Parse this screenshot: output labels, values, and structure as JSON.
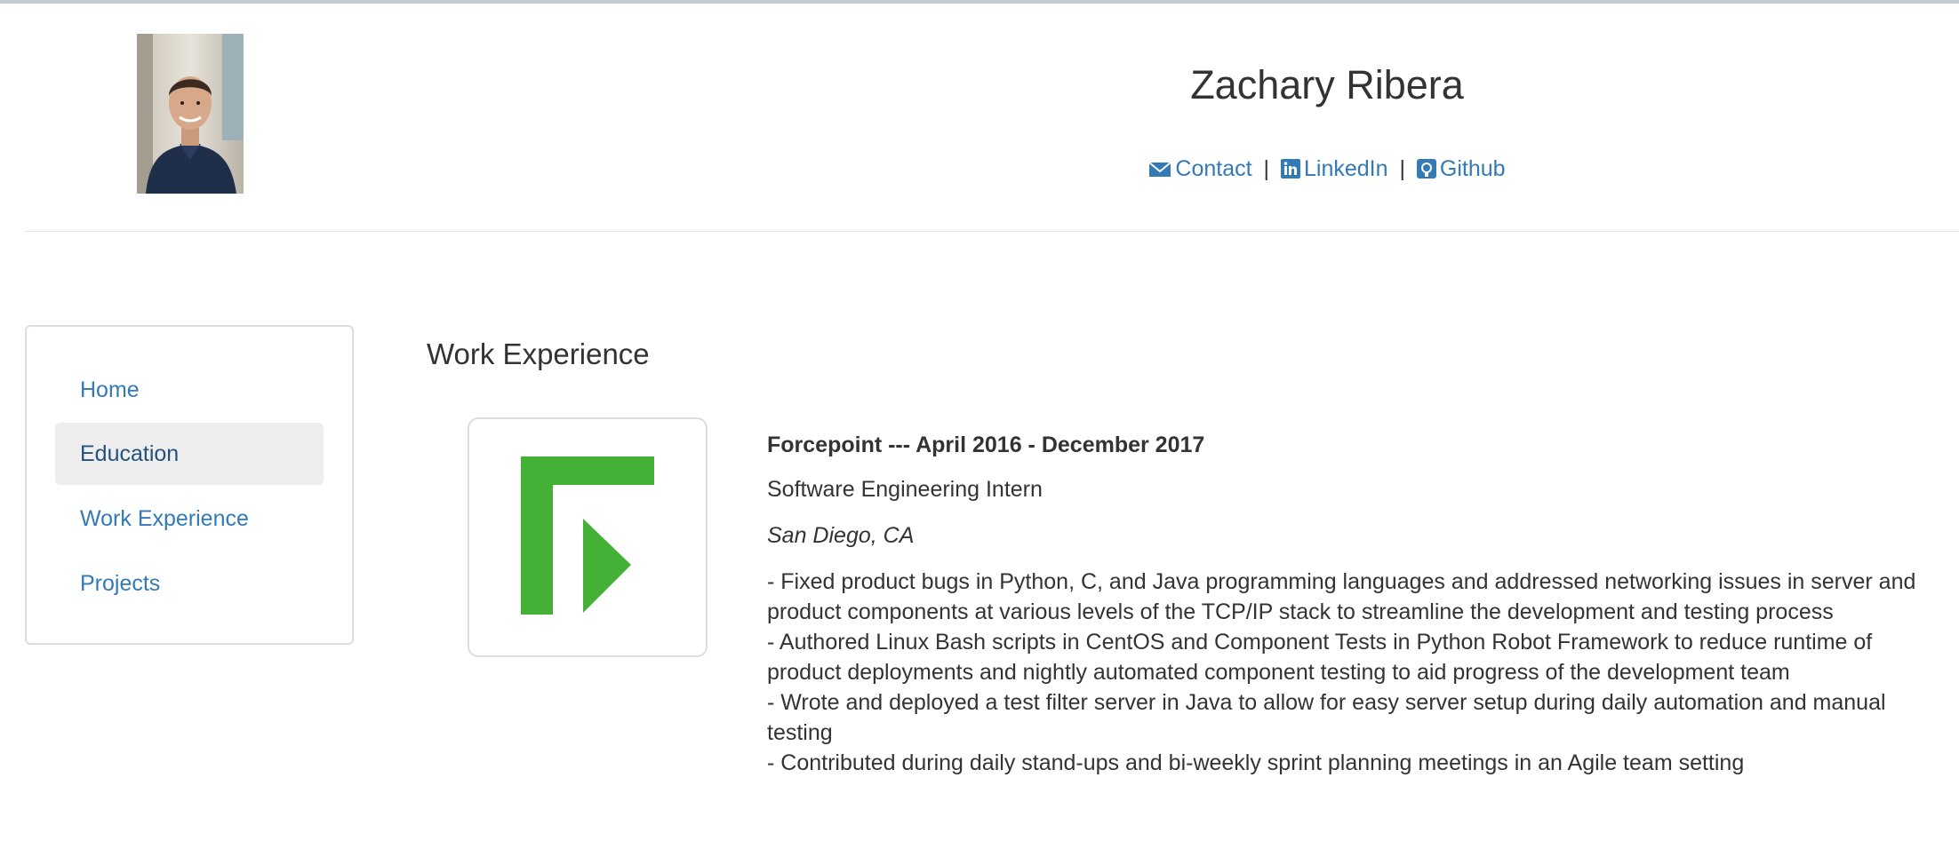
{
  "header": {
    "name": "Zachary Ribera",
    "links": {
      "contact": "Contact",
      "linkedin": "LinkedIn",
      "github": "Github",
      "separator": "|"
    },
    "link_icons": [
      "envelope-icon",
      "linkedin-icon",
      "github-icon"
    ]
  },
  "sidebar": {
    "items": [
      {
        "label": "Home"
      },
      {
        "label": "Education",
        "active": true
      },
      {
        "label": "Work Experience"
      },
      {
        "label": "Projects"
      }
    ]
  },
  "main": {
    "section_title": "Work Experience",
    "job": {
      "header": "Forcepoint --- April 2016 - December 2017",
      "title": "Software Engineering Intern",
      "location": "San Diego, CA",
      "bullets": [
        "- Fixed product bugs in Python, C, and Java programming languages and addressed networking issues in server and product components at various levels of the TCP/IP stack to streamline the development and testing process",
        "- Authored Linux Bash scripts in CentOS and Component Tests in Python Robot Framework to reduce runtime of product deployments and nightly automated component testing to aid progress of the development team",
        "- Wrote and deployed a test filter server in Java to allow for easy server setup during daily automation and manual testing",
        "- Contributed during daily stand-ups and bi-weekly sprint planning meetings in an Agile team setting"
      ]
    }
  },
  "colors": {
    "link": "#337ab7",
    "active_bg": "#eeeeee",
    "logo_green": "#44b035",
    "text": "#333333"
  }
}
